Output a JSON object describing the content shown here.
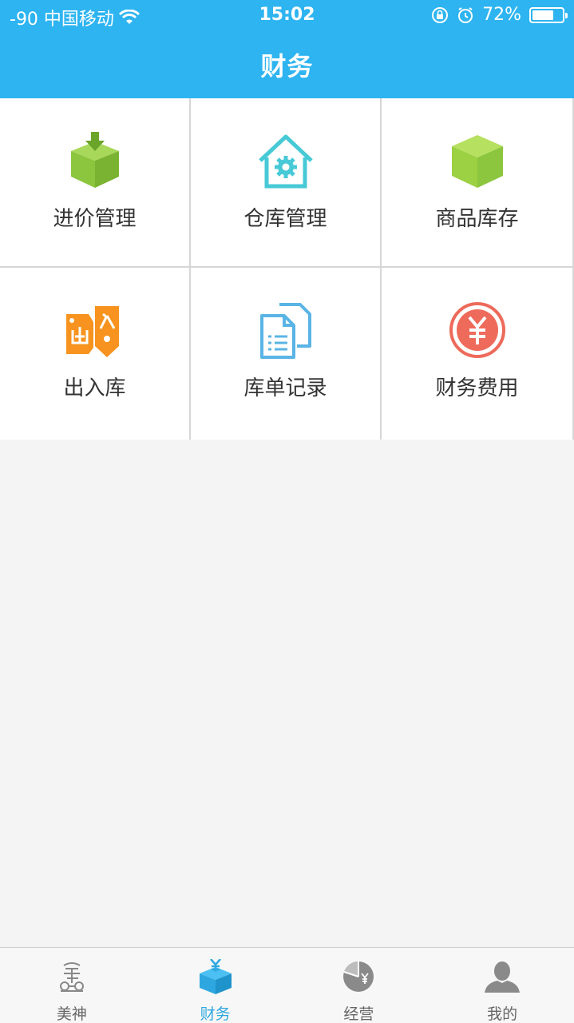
{
  "status_bar": {
    "carrier": "-90 中国移动",
    "time": "15:02",
    "battery": "72%",
    "battery_level": 0.72
  },
  "header": {
    "title": "财务"
  },
  "grid": {
    "items": [
      {
        "label": "进价管理",
        "icon": "box-download-icon"
      },
      {
        "label": "仓库管理",
        "icon": "warehouse-gear-icon"
      },
      {
        "label": "商品库存",
        "icon": "box-icon"
      },
      {
        "label": "出入库",
        "icon": "in-out-tags-icon"
      },
      {
        "label": "库单记录",
        "icon": "documents-icon"
      },
      {
        "label": "财务费用",
        "icon": "yen-circle-icon"
      }
    ]
  },
  "tabbar": {
    "tabs": [
      {
        "label": "美神",
        "icon": "meishen-logo-icon"
      },
      {
        "label": "财务",
        "icon": "yen-box-icon",
        "active": true
      },
      {
        "label": "经营",
        "icon": "pie-chart-icon"
      },
      {
        "label": "我的",
        "icon": "user-icon"
      }
    ]
  },
  "colors": {
    "header_bg": "#2db4f1",
    "tab_active": "#2ea7e0",
    "green": "#8cc63f",
    "teal": "#47c9d6",
    "orange": "#f7931e",
    "blue_doc": "#5ab4e5",
    "red": "#ee6a5a"
  }
}
